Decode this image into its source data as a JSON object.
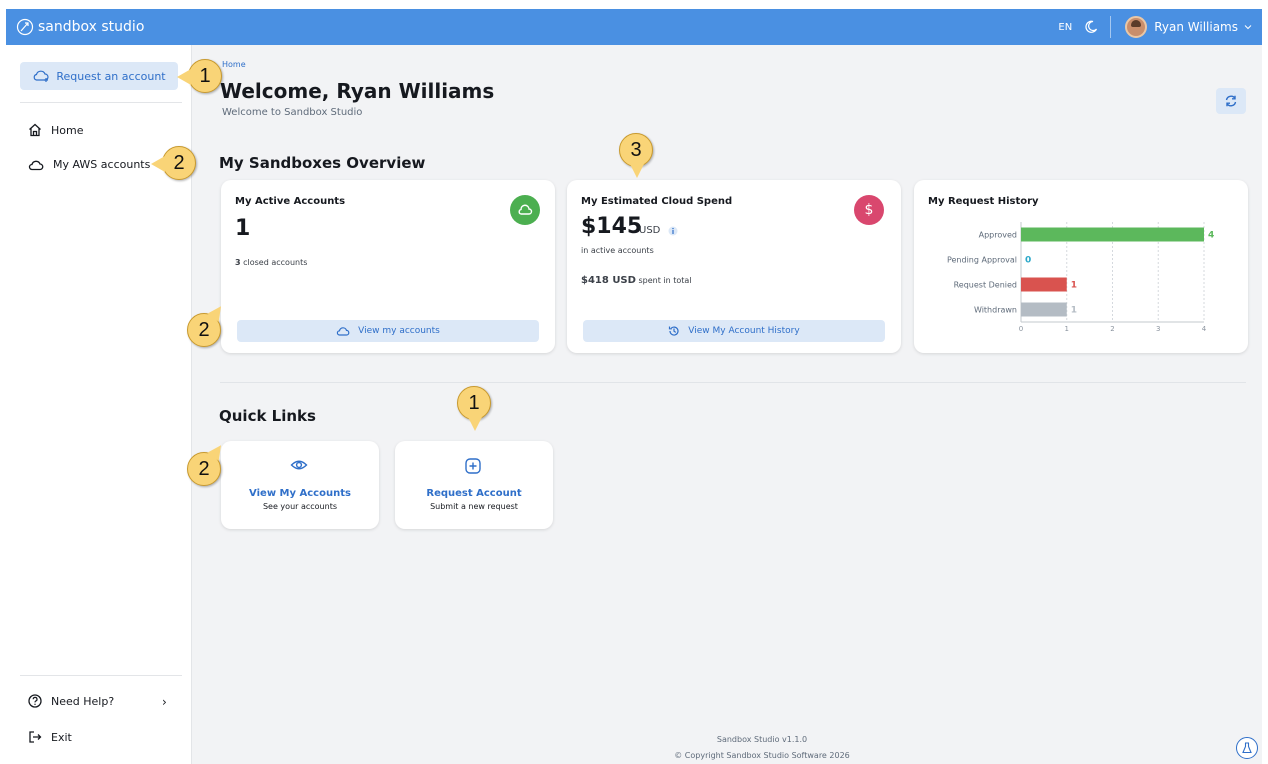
{
  "app": {
    "name": "sandbox studio"
  },
  "topbar": {
    "lang": "EN",
    "user_name": "Ryan Williams"
  },
  "sidebar": {
    "request_label": "Request an account",
    "items": [
      {
        "label": "Home",
        "icon": "home-icon"
      },
      {
        "label": "My AWS accounts",
        "icon": "cloud-icon"
      }
    ],
    "help_label": "Need Help?",
    "exit_label": "Exit"
  },
  "main": {
    "breadcrumb": "Home",
    "title": "Welcome, Ryan Williams",
    "subtitle": "Welcome to Sandbox Studio",
    "overview_title": "My Sandboxes Overview",
    "quick_links_title": "Quick Links"
  },
  "cards": {
    "active": {
      "title": "My Active Accounts",
      "count": "1",
      "closed_num": "3",
      "closed_text": "closed accounts",
      "button": "View my accounts",
      "icon_color": "#4caf50"
    },
    "spend": {
      "title": "My Estimated Cloud Spend",
      "amount": "$145",
      "currency": "USD",
      "amount_note": "in active accounts",
      "total_amount": "$418 USD",
      "total_text": "spent in total",
      "button": "View My Account History",
      "icon_color": "#d9476e"
    },
    "history": {
      "title": "My Request History"
    }
  },
  "chart_data": {
    "type": "bar",
    "orientation": "horizontal",
    "categories": [
      "Approved",
      "Pending Approval",
      "Request Denied",
      "Withdrawn"
    ],
    "values": [
      4,
      0,
      1,
      1
    ],
    "colors": [
      "#5cb85c",
      "#2aa8c9",
      "#d9534f",
      "#b4bcc4"
    ],
    "xlim": [
      0,
      4
    ],
    "xticks": [
      "0",
      "1",
      "2",
      "3",
      "4"
    ],
    "grid": true
  },
  "quick_links": [
    {
      "title": "View My Accounts",
      "subtitle": "See your accounts",
      "icon": "eye-icon"
    },
    {
      "title": "Request Account",
      "subtitle": "Submit a new request",
      "icon": "plus-square-icon"
    }
  ],
  "footer": {
    "version": "Sandbox Studio v1.1.0",
    "copyright": "© Copyright Sandbox Studio Software 2026"
  },
  "callouts": {
    "sidebar_request": "1",
    "sidebar_accounts": "2",
    "spend_card": "3",
    "view_accounts_btn": "2",
    "ql_view": "2",
    "ql_request": "1"
  }
}
